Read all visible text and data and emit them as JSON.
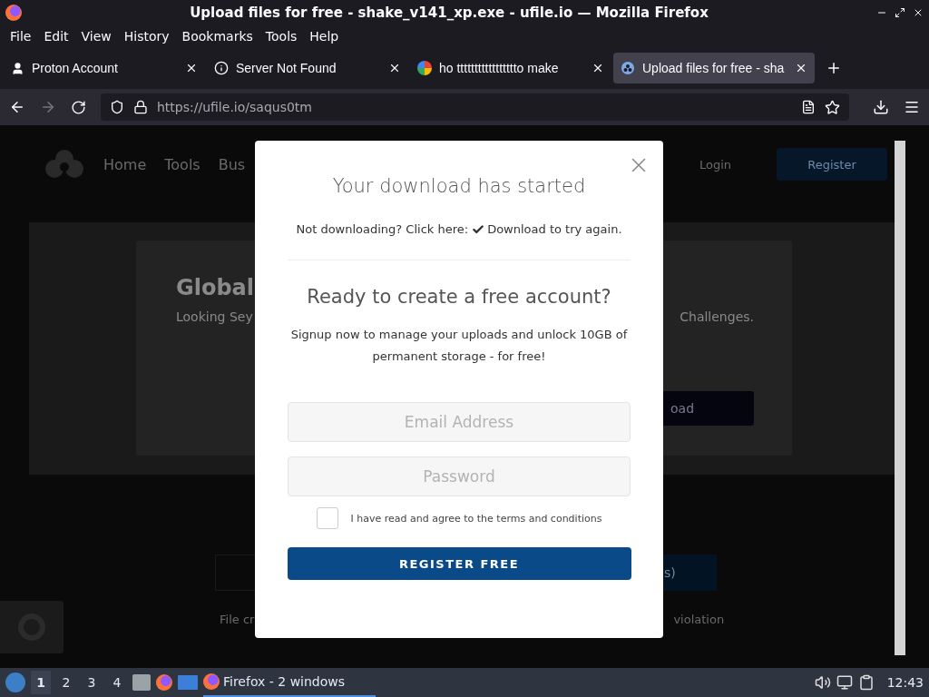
{
  "window": {
    "title": "Upload files for free - shake_v141_xp.exe - ufile.io — Mozilla Firefox"
  },
  "menu": [
    "File",
    "Edit",
    "View",
    "History",
    "Bookmarks",
    "Tools",
    "Help"
  ],
  "tabs": [
    {
      "label": "Proton Account",
      "kind": "person",
      "selected": false
    },
    {
      "label": "Server Not Found",
      "kind": "info",
      "selected": false
    },
    {
      "label": "ho ttttttttttttttttto make",
      "kind": "google",
      "selected": false
    },
    {
      "label": "Upload files for free - sha",
      "kind": "site",
      "selected": true
    }
  ],
  "address_bar": {
    "url_host": "https://ufile.io",
    "url_path": "/saqus0tm"
  },
  "page": {
    "nav": [
      "Home",
      "Tools",
      "Bus"
    ],
    "login": "Login",
    "register": "Register",
    "banner": {
      "title": "Global",
      "text_left": "Looking Sey",
      "text_right": "Challenges.",
      "button": "oad"
    },
    "button_right": "s)",
    "footer_left": "File cr",
    "footer_right": "violation"
  },
  "modal": {
    "title": "Your download has started",
    "retry_prefix": "Not downloading? Click here:",
    "retry_link": "Download to try again.",
    "heading": "Ready to create a free account?",
    "text": "Signup now to manage your uploads and unlock 10GB of permanent storage - for free!",
    "email_placeholder": "Email Address",
    "password_placeholder": "Password",
    "terms": {
      "label": "I have read and agree to the terms and conditions",
      "checked": false
    },
    "button": "REGISTER FREE"
  },
  "taskbar": {
    "workspaces": [
      {
        "label": "1",
        "selected": true
      },
      {
        "label": "2",
        "selected": false
      },
      {
        "label": "3",
        "selected": false
      },
      {
        "label": "4",
        "selected": false
      }
    ],
    "task": "Firefox - 2 windows",
    "clock": "12:43"
  }
}
